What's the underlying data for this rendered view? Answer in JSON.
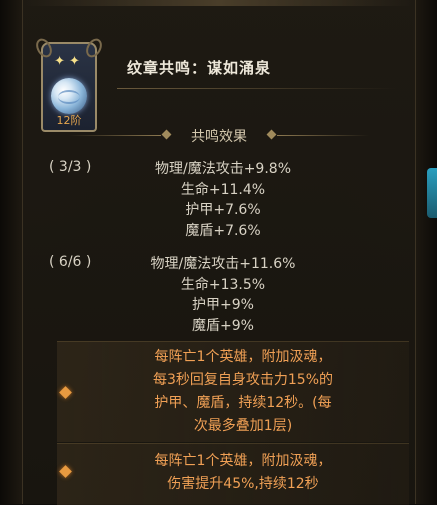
{
  "title": "纹章共鸣：谋如涌泉",
  "badge": {
    "level": "12阶",
    "stars": "✦✦"
  },
  "section_header": "共鸣效果",
  "tiers": [
    {
      "count": "( 3/3 )",
      "stats": [
        "物理/魔法攻击+9.8%",
        "生命+11.4%",
        "护甲+7.6%",
        "魔盾+7.6%"
      ]
    },
    {
      "count": "( 6/6 )",
      "stats": [
        "物理/魔法攻击+11.6%",
        "生命+13.5%",
        "护甲+9%",
        "魔盾+9%"
      ]
    }
  ],
  "effects": [
    {
      "lines": [
        "每阵亡1个英雄，附加汲魂，",
        "每3秒回复自身攻击力15%的",
        "护甲、魔盾，持续12秒。(每",
        "次最多叠加1层)"
      ]
    },
    {
      "lines": [
        "每阵亡1个英雄，附加汲魂，",
        "伤害提升45%,持续12秒"
      ]
    }
  ],
  "colors": {
    "effect_text": "#f0a055",
    "badge_level": "#e6a64e"
  }
}
